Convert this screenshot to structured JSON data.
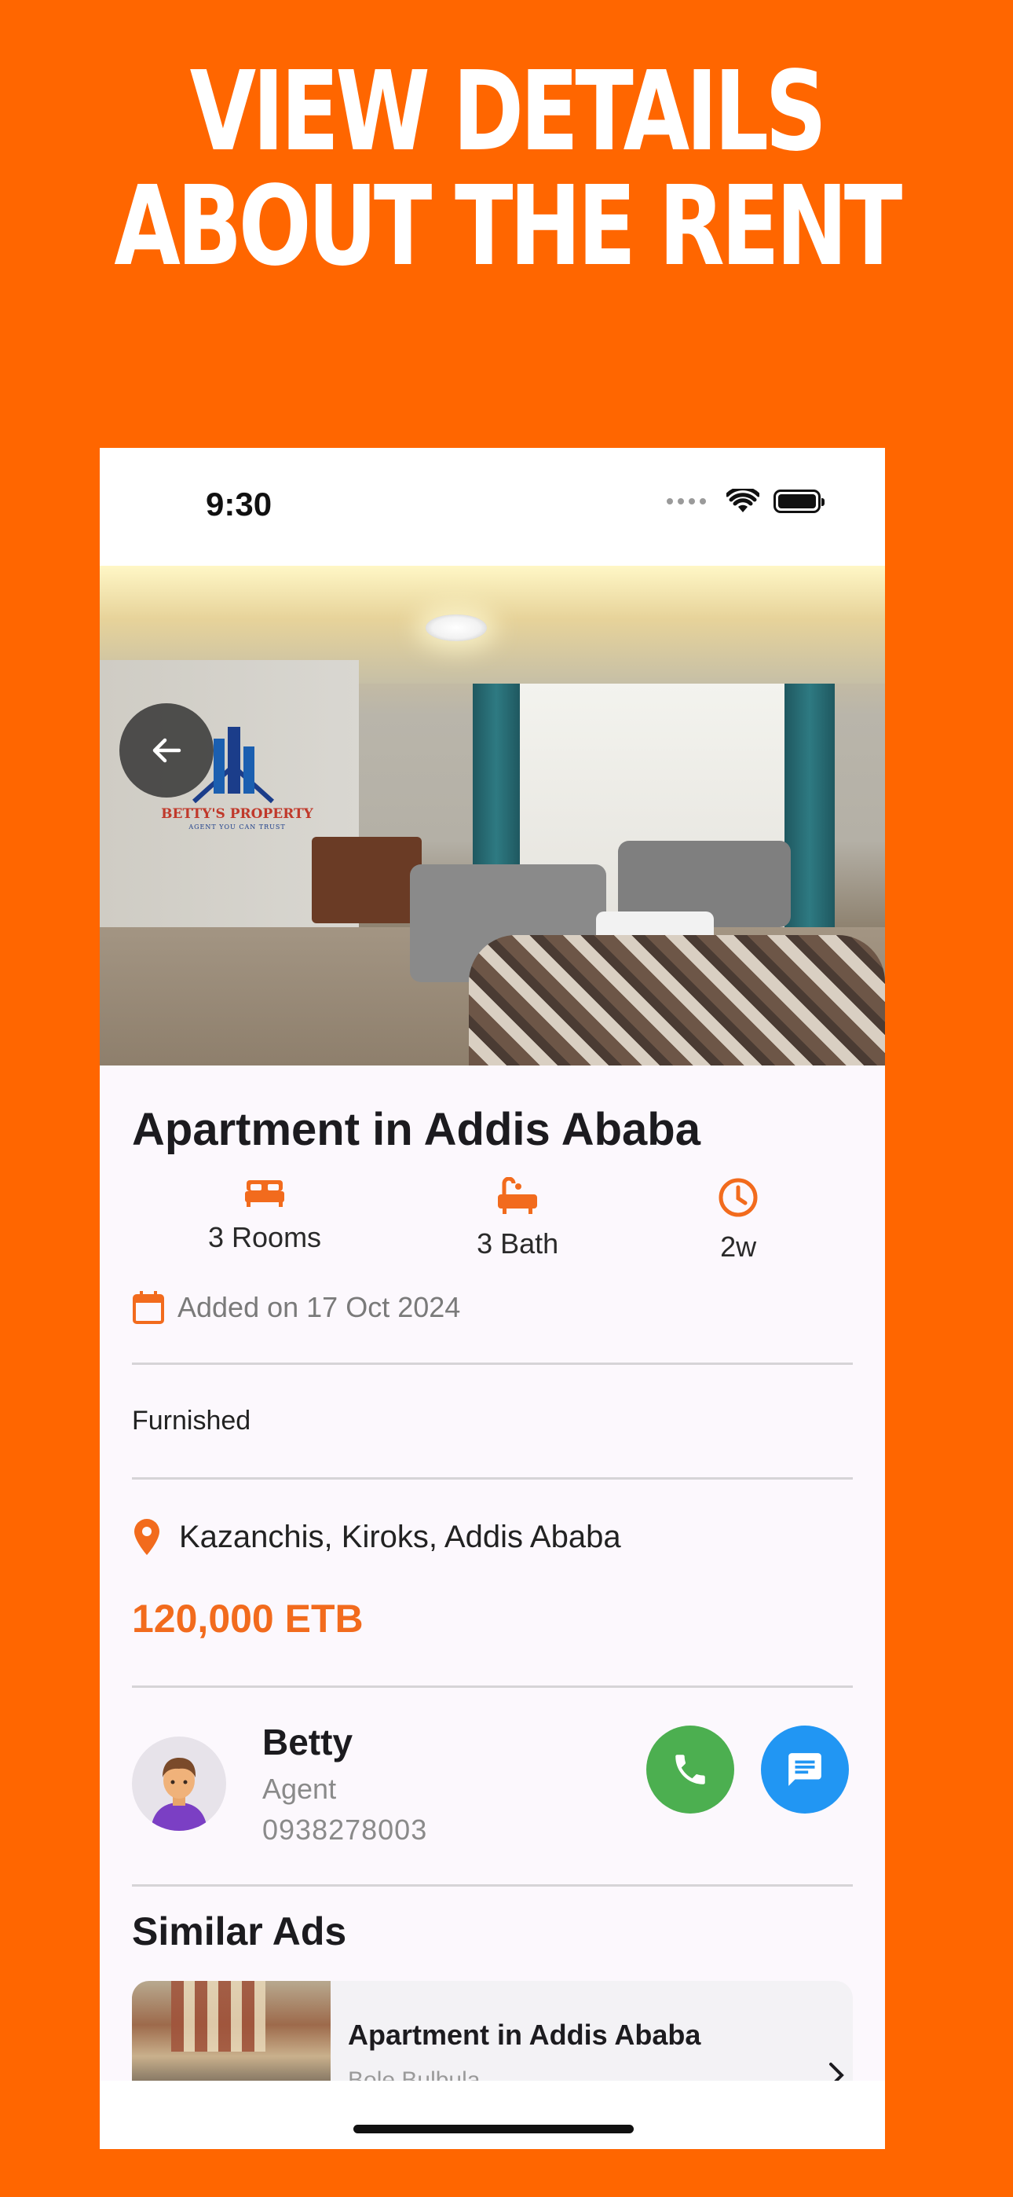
{
  "promo": {
    "headline_line1": "VIEW DETAILS",
    "headline_line2": "ABOUT THE RENT"
  },
  "status_bar": {
    "time": "9:30"
  },
  "listing": {
    "title": "Apartment in Addis Ababa",
    "features": [
      {
        "icon": "bed-icon",
        "label": "3 Rooms"
      },
      {
        "icon": "bathtub-icon",
        "label": "3 Bath"
      },
      {
        "icon": "clock-icon",
        "label": "2w"
      }
    ],
    "added_on": "Added on 17 Oct 2024",
    "furnishing": "Furnished",
    "location": "Kazanchis, Kiroks, Addis Ababa",
    "price": "120,000 ETB",
    "image_watermark": {
      "brand": "BETTY'S PROPERTY",
      "tagline": "AGENT YOU CAN TRUST"
    }
  },
  "agent": {
    "name": "Betty",
    "role": "Agent",
    "phone": "0938278003"
  },
  "similar": {
    "title": "Similar Ads",
    "items": [
      {
        "title": "Apartment in Addis Ababa",
        "subtitle": "Bole Bulbula"
      }
    ]
  },
  "colors": {
    "accent": "#FF6600",
    "price": "#F26B1D",
    "call": "#4CAF50",
    "chat": "#2196F3"
  }
}
